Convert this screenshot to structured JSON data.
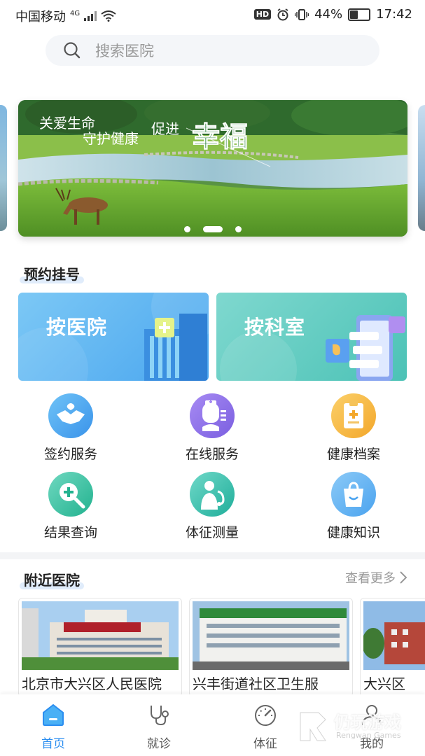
{
  "status_bar": {
    "carrier": "中国移动",
    "network": "4G",
    "hd_badge": "HD",
    "battery_percent": "44%",
    "battery_level": 0.44,
    "time": "17:42"
  },
  "search": {
    "placeholder": "搜索医院"
  },
  "banner": {
    "text_line1": "关爱生命",
    "text_line2": "守护健康",
    "text_promote": "促进",
    "text_happiness": "幸福",
    "dots_count": 3,
    "active_dot": 1
  },
  "appointment": {
    "title": "预约挂号",
    "by_hospital": "按医院",
    "by_department": "按科室"
  },
  "services": [
    {
      "label": "签约服务",
      "icon": "handshake-icon",
      "color": "#3aa0f0"
    },
    {
      "label": "在线服务",
      "icon": "doctor-icon",
      "color": "#8a6fe8"
    },
    {
      "label": "健康档案",
      "icon": "clipboard-icon",
      "color": "#f5a623"
    },
    {
      "label": "结果查询",
      "icon": "search-plus-icon",
      "color": "#26b99a"
    },
    {
      "label": "体征测量",
      "icon": "stethoscope-person-icon",
      "color": "#2bb5a0"
    },
    {
      "label": "健康知识",
      "icon": "bag-icon",
      "color": "#4aa8f3"
    }
  ],
  "nearby": {
    "title": "附近医院",
    "more_label": "查看更多",
    "hospitals": [
      {
        "name": "北京市大兴区人民医院"
      },
      {
        "name": "兴丰街道社区卫生服"
      },
      {
        "name": "大兴区"
      }
    ]
  },
  "tabbar": {
    "items": [
      {
        "label": "首页",
        "icon": "home-icon",
        "active": true
      },
      {
        "label": "就诊",
        "icon": "stethoscope-icon",
        "active": false
      },
      {
        "label": "体征",
        "icon": "gauge-icon",
        "active": false
      },
      {
        "label": "我的",
        "icon": "user-icon",
        "active": false
      }
    ]
  },
  "watermark": {
    "text": "仍玩游戏",
    "sub": "Rengwan Games"
  },
  "colors": {
    "accent": "#2b8ef0"
  }
}
